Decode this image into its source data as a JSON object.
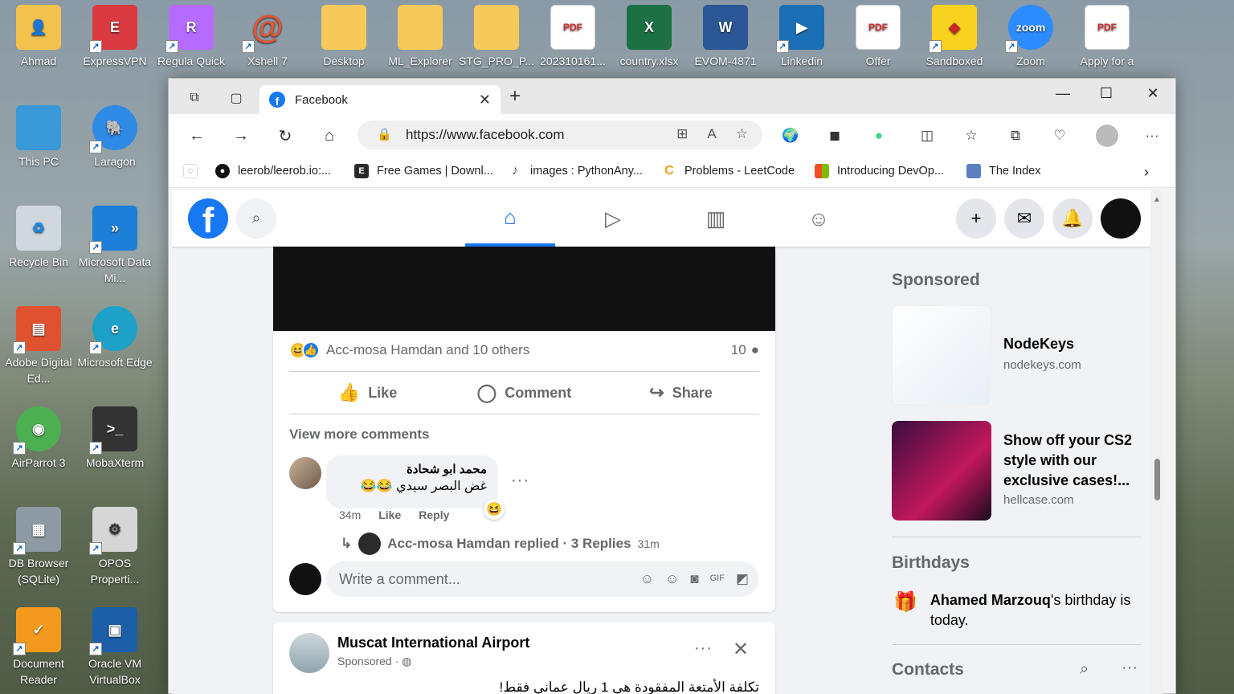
{
  "desktop": {
    "icons": [
      {
        "label": "Ahmad",
        "color": "#f2c14e"
      },
      {
        "label": "ExpressVPN",
        "color": "#da3940"
      },
      {
        "label": "Regula Quick",
        "color": "#b56bff"
      },
      {
        "label": "Xshell 7",
        "color": "#e8552e"
      },
      {
        "label": "Desktop",
        "color": "#f5c95a"
      },
      {
        "label": "ML_Explorer",
        "color": "#f5c95a"
      },
      {
        "label": "STG_PRO_P...",
        "color": "#f5c95a"
      },
      {
        "label": "202310161...",
        "color": "#ffffff"
      },
      {
        "label": "country.xlsx",
        "color": "#1d7044"
      },
      {
        "label": "EVOM-4871",
        "color": "#2b5797"
      },
      {
        "label": "Linkedin",
        "color": "#1b6fb5"
      },
      {
        "label": "Offer",
        "color": "#ffffff"
      },
      {
        "label": "Sandboxed",
        "color": "#f7d21e"
      },
      {
        "label": "Zoom",
        "color": "#2d8cff"
      },
      {
        "label": "Apply for a",
        "color": "#ffffff"
      }
    ],
    "left_icons": [
      {
        "label": "This PC",
        "color": "#3a9ad9"
      },
      {
        "label": "Laragon",
        "color": "#2f8ae6"
      },
      {
        "label": "Recycle Bin",
        "color": "#cfd8dc"
      },
      {
        "label": "Microsoft Data Mi...",
        "color": "#1e7fd8"
      },
      {
        "label": "Adobe Digital Ed...",
        "color": "#e0522f"
      },
      {
        "label": "Microsoft Edge",
        "color": "#1da1c9"
      },
      {
        "label": "AirParrot 3",
        "color": "#4caf50"
      },
      {
        "label": "MobaXterm",
        "color": "#333333"
      },
      {
        "label": "DB Browser (SQLite)",
        "color": "#8d9aa3"
      },
      {
        "label": "OPOS Properti...",
        "color": "#d6d6d6"
      },
      {
        "label": "Document Reader",
        "color": "#f39a1e"
      },
      {
        "label": "Oracle VM VirtualBox",
        "color": "#1c5ea8"
      }
    ]
  },
  "browser": {
    "tab": {
      "title": "Facebook",
      "icon": "facebook-icon"
    },
    "url": "https://www.facebook.com",
    "bookmarks": [
      {
        "label": "leerob/leerob.io:...",
        "icon": "github-icon",
        "color": "#111111"
      },
      {
        "label": "Free Games | Downl...",
        "icon": "epic-icon",
        "color": "#2a2a2a"
      },
      {
        "label": "images : PythonAny...",
        "icon": "python-icon",
        "color": "#4a4a4a"
      },
      {
        "label": "Problems - LeetCode",
        "icon": "leetcode-icon",
        "color": "#f89f1b"
      },
      {
        "label": "Introducing DevOp...",
        "icon": "microsoft-icon",
        "color": "#f25022"
      },
      {
        "label": "The Index",
        "icon": "index-icon",
        "color": "#5b7fbf"
      }
    ]
  },
  "facebook": {
    "post": {
      "reaction_text": "Acc-mosa Hamdan and 10 others",
      "comment_count": "10",
      "actions": [
        "Like",
        "Comment",
        "Share"
      ],
      "view_more": "View more comments",
      "comment": {
        "author": "محمد ابو شحادة",
        "text": "غض البصر سيدي 😂😂",
        "time": "34m",
        "like": "Like",
        "reply": "Reply"
      },
      "replies": {
        "text": "Acc-mosa Hamdan replied · 3 Replies",
        "time": "31m"
      },
      "write_placeholder": "Write a comment..."
    },
    "post2": {
      "author": "Muscat International Airport",
      "sponsored": "Sponsored ·",
      "text": "تكلفة الأمتعة المفقودة هي 1 ريال عماني فقط!"
    },
    "sidebar": {
      "sponsored_title": "Sponsored",
      "ads": [
        {
          "title": "NodeKeys",
          "domain": "nodekeys.com"
        },
        {
          "title": "Show off your CS2 style with our exclusive cases!...",
          "domain": "hellcase.com"
        }
      ],
      "birthdays_title": "Birthdays",
      "birthday_name": "Ahamed Marzouq",
      "birthday_suffix": "'s birthday is today.",
      "contacts_title": "Contacts"
    }
  }
}
